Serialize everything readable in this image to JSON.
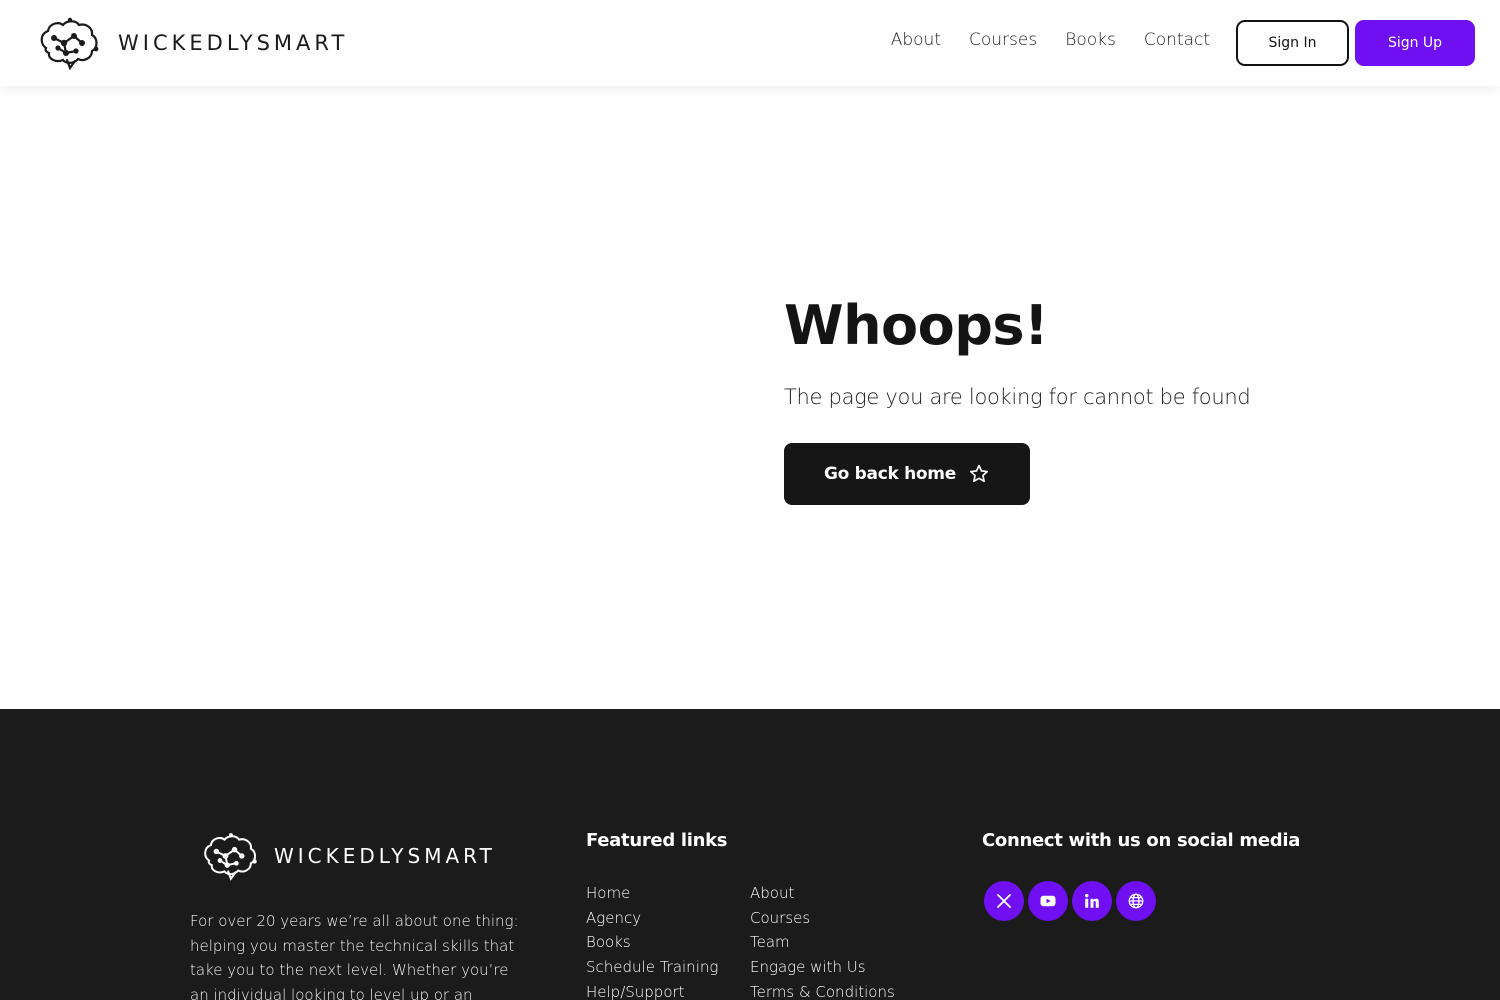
{
  "header": {
    "logo_text": "WICKEDLYSMART",
    "nav": [
      "About",
      "Courses",
      "Books",
      "Contact"
    ],
    "sign_in": "Sign In",
    "sign_up": "Sign Up"
  },
  "main": {
    "title": "Whoops!",
    "message": "The page you are looking for cannot be found",
    "home_button": "Go back home",
    "home_button_icon": "star-icon"
  },
  "footer": {
    "logo_text": "WICKEDLYSMART",
    "about_text": "For over 20 years we’re all about one thing: helping you master the technical skills that take you to the next level. Whether you’re an individual looking to level up or an",
    "featured_heading": "Featured links",
    "links_col1": [
      "Home",
      "Agency",
      "Books",
      "Schedule Training",
      "Help/Support"
    ],
    "links_col2": [
      "About",
      "Courses",
      "Team",
      "Engage with Us",
      "Terms & Conditions"
    ],
    "social_heading": "Connect with us on social media",
    "social_icons": [
      "x-icon",
      "youtube-icon",
      "linkedin-icon",
      "globe-icon"
    ]
  },
  "colors": {
    "accent": "#6f0ff2",
    "dark": "#161616",
    "footer_bg": "#1b1b1b"
  }
}
